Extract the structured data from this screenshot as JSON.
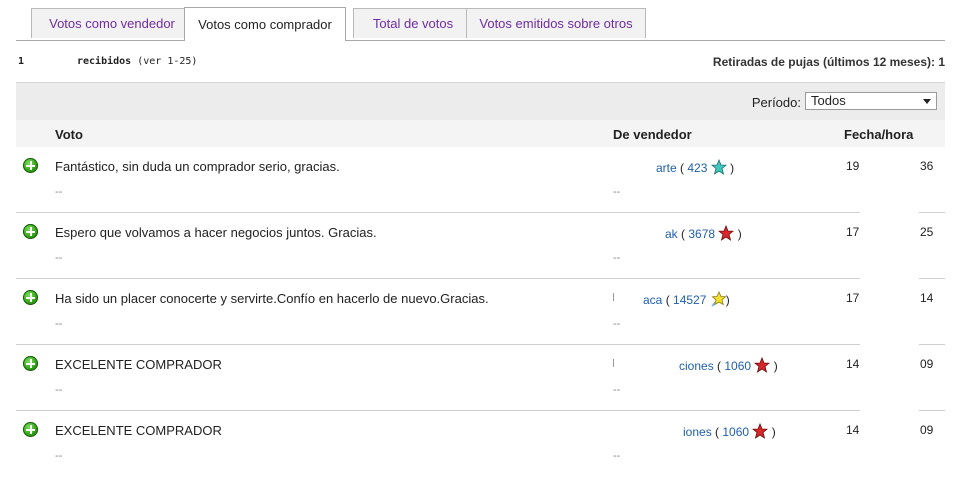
{
  "tabs": [
    {
      "label": "Votos como vendedor"
    },
    {
      "label": "Votos como comprador"
    },
    {
      "label": "Total de votos"
    },
    {
      "label": "Votos emitidos sobre otros"
    }
  ],
  "summary": {
    "count": "1",
    "received_label": "recibidos",
    "range": "(ver 1-25)",
    "retiradas": "Retiradas de pujas (últimos 12 meses): 1"
  },
  "filter": {
    "label": "Período:",
    "selected": "Todos"
  },
  "columns": {
    "voto": "Voto",
    "vendedor": "De vendedor",
    "fecha": "Fecha/hora"
  },
  "rows": [
    {
      "comment": "Fantástico, sin duda un comprador serio, gracias.",
      "reply": "--",
      "reply_seller": "--",
      "seller": "arte",
      "score": "423",
      "star_color": "#3fc7c0",
      "date1": "19",
      "date2": "36"
    },
    {
      "comment": "Espero que volvamos a hacer negocios juntos. Gracias.",
      "reply": "--",
      "reply_seller": "--",
      "seller": "ak",
      "score": "3678",
      "star_color": "#d8262a",
      "date1": "17",
      "date2": "25"
    },
    {
      "comment": "Ha sido un placer conocerte y servirte.Confío en hacerlo de nuevo.Gracias.",
      "reply": "--",
      "reply_seller": "--",
      "seller": "aca",
      "score": "14527",
      "star_color": "#f3e12c",
      "date1": "17",
      "date2": "14"
    },
    {
      "comment": "EXCELENTE COMPRADOR",
      "reply": "--",
      "reply_seller": "--",
      "seller": "ciones",
      "score": "1060",
      "star_color": "#d8262a",
      "date1": "14",
      "date2": "09"
    },
    {
      "comment": "EXCELENTE COMPRADOR",
      "reply": "--",
      "reply_seller": "--",
      "seller": "iones",
      "score": "1060",
      "star_color": "#d8262a",
      "date1": "14",
      "date2": "09"
    }
  ]
}
